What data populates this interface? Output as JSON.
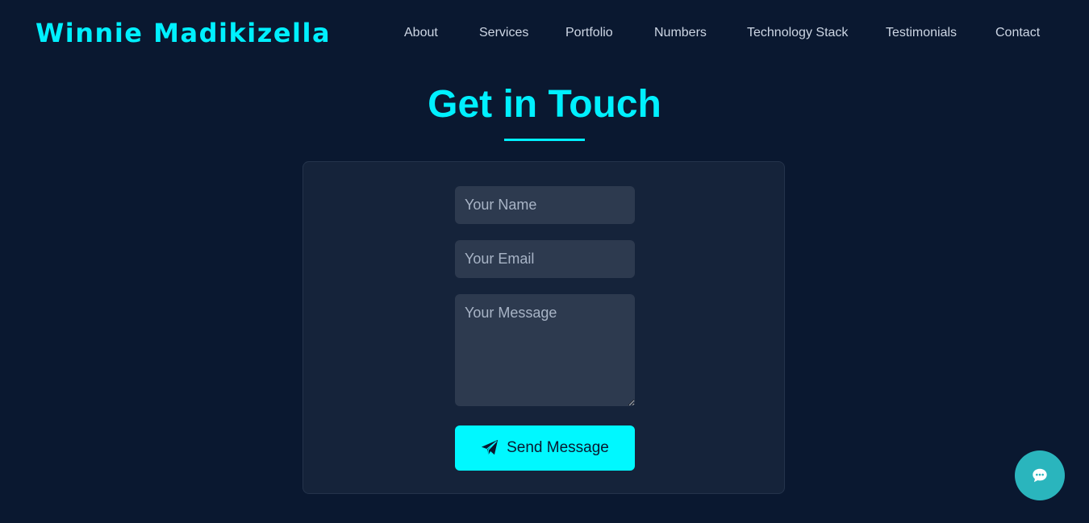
{
  "header": {
    "brand": "Winnie Madikizella",
    "nav": [
      "About",
      "Services",
      "Portfolio",
      "Numbers",
      "Technology Stack",
      "Testimonials",
      "Contact"
    ]
  },
  "contact": {
    "title": "Get in Touch",
    "name_placeholder": "Your Name",
    "email_placeholder": "Your Email",
    "message_placeholder": "Your Message",
    "send_label": "Send Message",
    "send_icon": "paper-plane-icon"
  },
  "chat": {
    "icon": "chat-bubble-icon"
  },
  "colors": {
    "background": "#0a1830",
    "accent": "#00f0ff",
    "card": "#15233a",
    "field": "#2d3a4f",
    "chat_button": "#2ab5bd"
  }
}
